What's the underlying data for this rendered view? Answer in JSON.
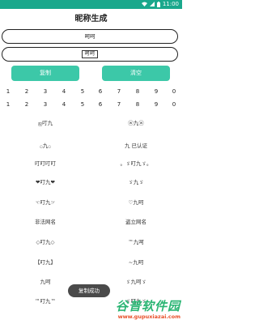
{
  "status_bar": {
    "time": "11:00",
    "bg_color": "#1aa88c"
  },
  "title": "昵称生成",
  "input_primary": {
    "value": "呵呵"
  },
  "input_styled": {
    "value": "呵呵"
  },
  "buttons": {
    "copy": "复制",
    "clear": "清空",
    "color": "#3cc8a8"
  },
  "number_rows": [
    [
      "1",
      "2",
      "3",
      "4",
      "5",
      "6",
      "7",
      "8",
      "9",
      "0"
    ],
    [
      "1",
      "2",
      "3",
      "4",
      "5",
      "6",
      "7",
      "8",
      "9",
      "0"
    ]
  ],
  "nicknames": [
    [
      "ஐ叮九",
      "ⓦ九ⓦ"
    ],
    [
      "۞九۞",
      "九 已认证"
    ],
    [
      "叮叮叮叮",
      "。ゞ叮九ゞ。"
    ],
    [
      "❤叮九❤",
      "ゞ九ゞ"
    ],
    [
      "☜叮九☞",
      "♡九呵"
    ],
    [
      "非法网名",
      "盗立网名"
    ],
    [
      "◇叮九◇",
      "™九呵"
    ],
    [
      "【叮九】",
      "~九呵"
    ],
    [
      "九呵",
      "ゞ九呵ゞ"
    ],
    [
      "™叮九™",
      "ゞ叮九ゞ"
    ]
  ],
  "toast": "复制成功",
  "watermark": {
    "title": "谷普软件园",
    "url": "www.gupuxiazai.com"
  }
}
